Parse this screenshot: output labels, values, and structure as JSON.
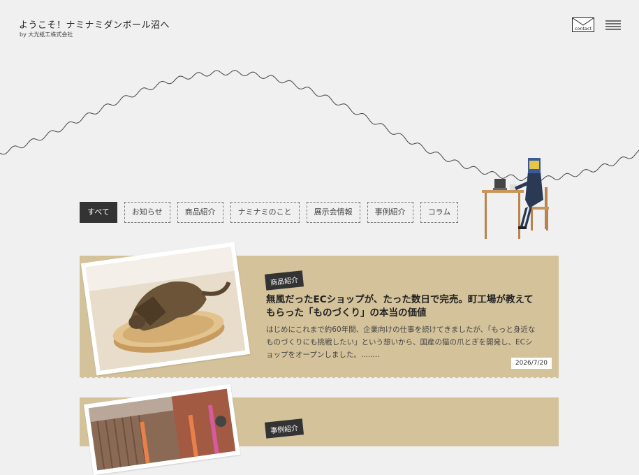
{
  "header": {
    "title": "ようこそ！ナミナミダンボール沼へ",
    "subtitle": "by 大光紙工株式会社",
    "contact_label": "contact"
  },
  "tabs": [
    {
      "label": "すべて",
      "active": true
    },
    {
      "label": "お知らせ",
      "active": false
    },
    {
      "label": "商品紹介",
      "active": false
    },
    {
      "label": "ナミナミのこと",
      "active": false
    },
    {
      "label": "展示会情報",
      "active": false
    },
    {
      "label": "事例紹介",
      "active": false
    },
    {
      "label": "コラム",
      "active": false
    }
  ],
  "posts": [
    {
      "category": "商品紹介",
      "title": "無風だったECショップが、たった数日で完売。町工場が教えてもらった「ものづくり」の本当の価値",
      "excerpt": "はじめにこれまで約60年間、企業向けの仕事を続けてきましたが、「もっと身近なものづくりにも挑戦したい」という想いから、国産の猫の爪とぎを開発し、ECショップをオープンしました。........",
      "date": "2026/7/20"
    },
    {
      "category": "事例紹介"
    }
  ],
  "colors": {
    "background": "#f0f0f0",
    "card": "#d4c29a",
    "active_tab": "#333333"
  }
}
